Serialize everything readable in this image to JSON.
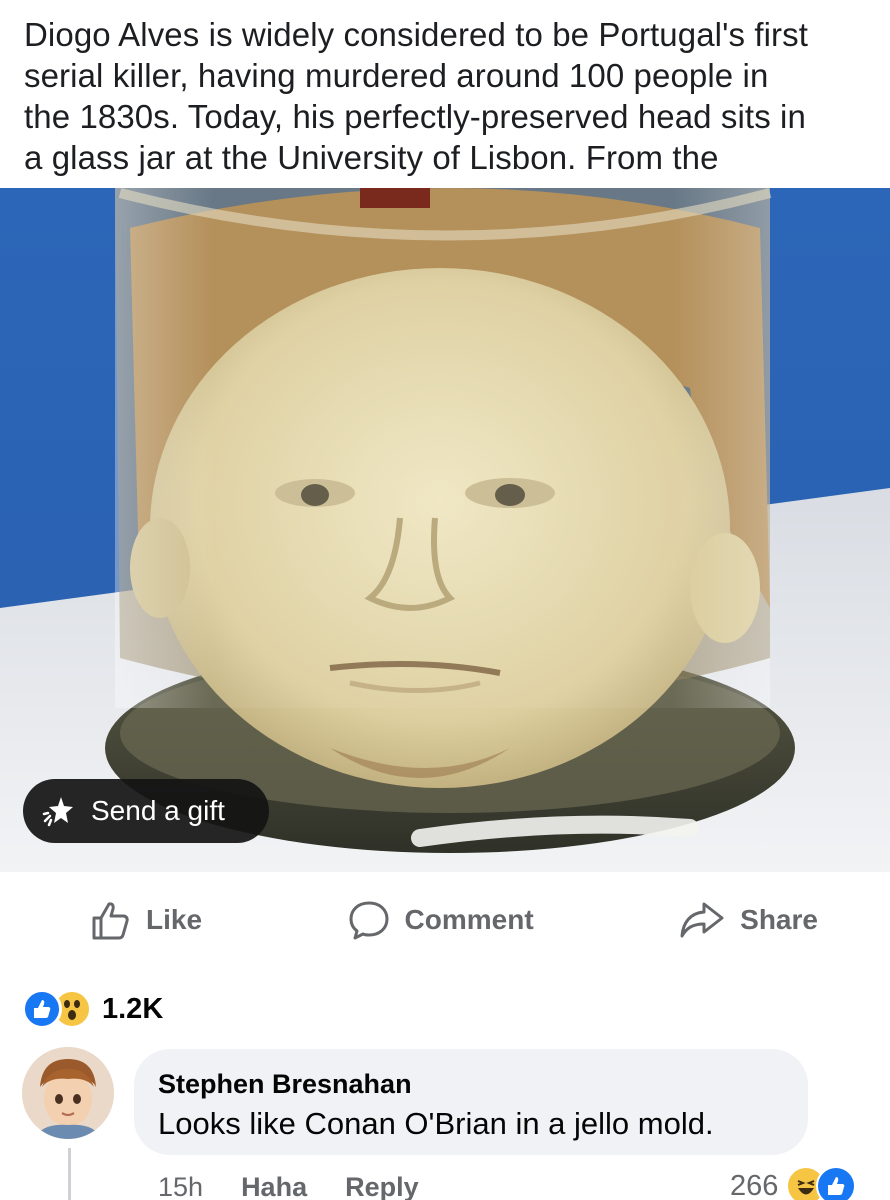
{
  "post": {
    "text_lines": [
      "Diogo Alves is widely considered to be Portugal's first",
      "serial killer, having murdered around 100 people in",
      "the 1830s. Today, his perfectly-preserved head sits in",
      "a glass jar at the University of Lisbon. From the"
    ]
  },
  "photo": {
    "subject": "preserved head in glass jar",
    "gift_button_label": "Send a gift",
    "gift_icon": "gift-sparkle-icon"
  },
  "actions": {
    "like_label": "Like",
    "comment_label": "Comment",
    "share_label": "Share"
  },
  "reactions": {
    "types": [
      "like",
      "wow"
    ],
    "count": "1.2K"
  },
  "comment": {
    "author": "Stephen Bresnahan",
    "text": "Looks like Conan O'Brian in a jello mold.",
    "time": "15h",
    "reaction_label": "Haha",
    "reply_label": "Reply",
    "reaction_count": "266",
    "reaction_types": [
      "haha",
      "like"
    ]
  },
  "colors": {
    "facebook_blue": "#1877f2",
    "meta_gray": "#65676b",
    "bubble_bg": "#f0f2f5",
    "wall_blue": "#2f6fc4"
  }
}
